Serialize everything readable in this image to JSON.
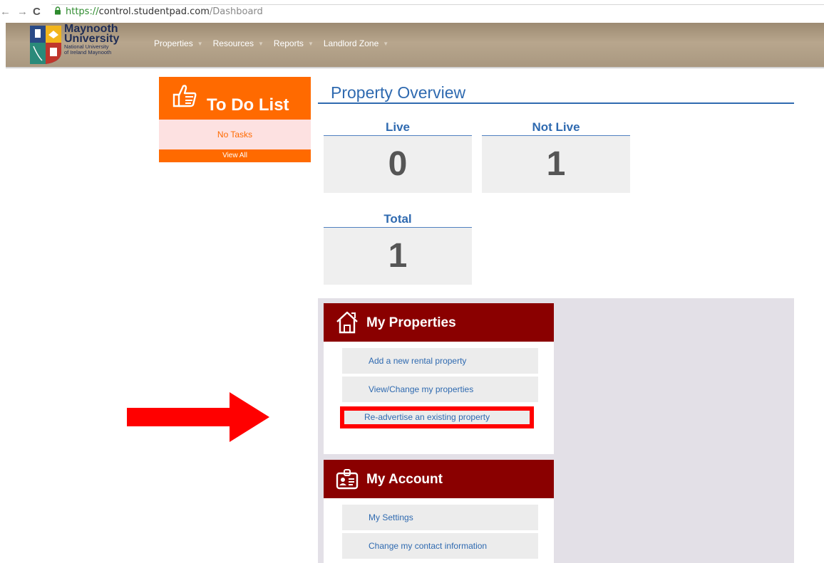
{
  "browser": {
    "url_scheme": "https://",
    "url_host": "control.studentpad.com",
    "url_path": "/Dashboard"
  },
  "brand": {
    "line1": "Maynooth",
    "line2": "University",
    "line3": "National University",
    "line4": "of Ireland Maynooth"
  },
  "nav": {
    "items": [
      {
        "label": "Properties"
      },
      {
        "label": "Resources"
      },
      {
        "label": "Reports"
      },
      {
        "label": "Landlord Zone"
      }
    ],
    "caret": "▼"
  },
  "todo": {
    "title": "To Do List",
    "empty_text": "No Tasks",
    "view_all": "View All"
  },
  "overview": {
    "title": "Property Overview",
    "live_label": "Live",
    "live_value": "0",
    "notlive_label": "Not Live",
    "notlive_value": "1",
    "total_label": "Total",
    "total_value": "1"
  },
  "my_properties": {
    "title": "My Properties",
    "links": [
      {
        "label": "Add a new rental property"
      },
      {
        "label": "View/Change my properties"
      },
      {
        "label": "Re-advertise an existing property"
      }
    ]
  },
  "my_account": {
    "title": "My Account",
    "links": [
      {
        "label": "My Settings"
      },
      {
        "label": "Change my contact information"
      }
    ]
  },
  "colors": {
    "nav_bg": "#b8a68d",
    "todo_orange": "#ff6a00",
    "panel_red": "#8a0000",
    "link_blue": "#2f6ab0",
    "annotation_red": "#ff0000"
  }
}
